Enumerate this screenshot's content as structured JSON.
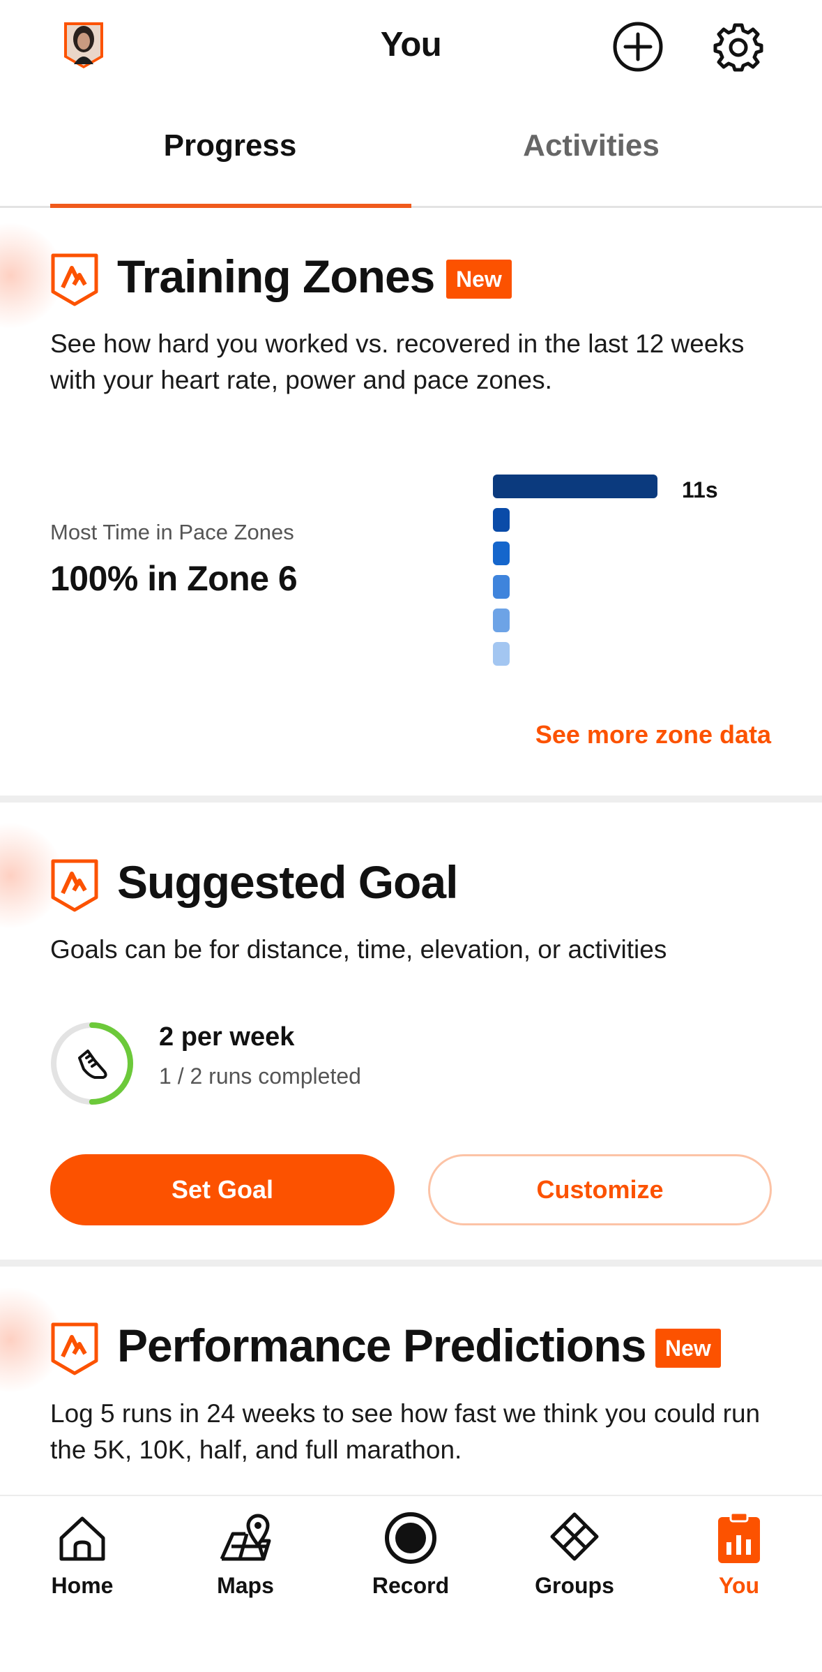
{
  "header": {
    "title": "You",
    "avatar_icon": "user-avatar",
    "add_icon": "plus-circle-icon",
    "settings_icon": "gear-icon"
  },
  "tabs": [
    {
      "label": "Progress",
      "active": true
    },
    {
      "label": "Activities",
      "active": false
    }
  ],
  "training_zones": {
    "title": "Training Zones",
    "badge": "New",
    "description": "See how hard you worked vs. recovered in the last 12 weeks with your heart rate, power and pace zones.",
    "caption": "Most Time in Pace Zones",
    "value": "100% in Zone 6",
    "bars": [
      {
        "zone": 6,
        "fraction": 1.0,
        "color": "#0b3a7e",
        "label": "11s"
      },
      {
        "zone": 5,
        "fraction": 0.0,
        "color": "#0a4ba8",
        "label": ""
      },
      {
        "zone": 4,
        "fraction": 0.0,
        "color": "#1566cc",
        "label": ""
      },
      {
        "zone": 3,
        "fraction": 0.0,
        "color": "#3f84dc",
        "label": ""
      },
      {
        "zone": 2,
        "fraction": 0.0,
        "color": "#6da3e6",
        "label": ""
      },
      {
        "zone": 1,
        "fraction": 0.0,
        "color": "#a3c6f1",
        "label": ""
      }
    ],
    "link": "See more zone data"
  },
  "suggested_goal": {
    "title": "Suggested Goal",
    "description": "Goals can be for distance, time, elevation, or activities",
    "goal_title": "2 per week",
    "goal_progress": "1 / 2 runs completed",
    "progress_fraction": 0.5,
    "progress_color": "#6cc93a",
    "goal_icon": "running-shoe-icon",
    "primary_button": "Set Goal",
    "secondary_button": "Customize"
  },
  "performance_predictions": {
    "title": "Performance Predictions",
    "badge": "New",
    "description": "Log 5 runs in 24 weeks to see how fast we think you could run the 5K, 10K, half, and full marathon."
  },
  "bottom_nav": [
    {
      "label": "Home",
      "icon": "home-icon",
      "active": false
    },
    {
      "label": "Maps",
      "icon": "map-icon",
      "active": false
    },
    {
      "label": "Record",
      "icon": "record-icon",
      "active": false
    },
    {
      "label": "Groups",
      "icon": "groups-icon",
      "active": false
    },
    {
      "label": "You",
      "icon": "you-stats-icon",
      "active": true
    }
  ],
  "colors": {
    "accent": "#fc5200",
    "text": "#111111",
    "muted": "#666666"
  }
}
